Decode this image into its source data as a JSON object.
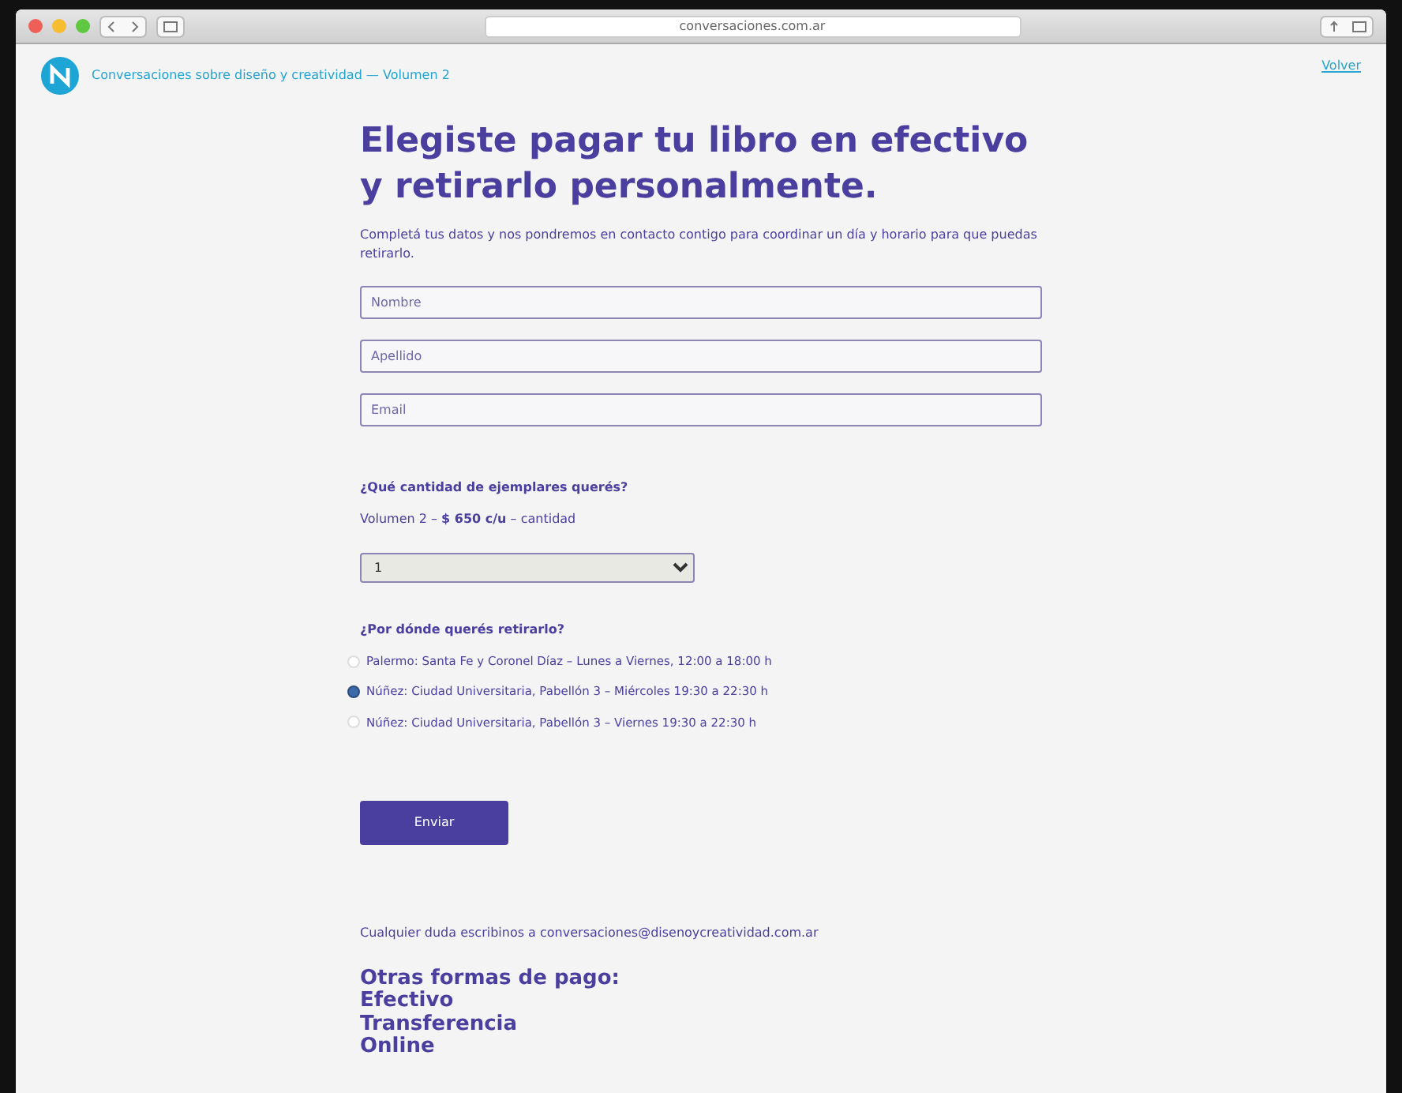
{
  "browser": {
    "address": "conversaciones.com.ar"
  },
  "header": {
    "site_title": "Conversaciones sobre diseño y creatividad — Volumen 2",
    "nav_link": "Volver"
  },
  "title": "Elegiste pagar tu libro en efectivo y retirarlo personalmente.",
  "intro": "Completá tus datos y nos pondremos en contacto contigo para coordinar un día y horario para que puedas retirarlo.",
  "fields": [
    {
      "placeholder": "Nombre"
    },
    {
      "placeholder": "Apellido"
    },
    {
      "placeholder": "Email"
    }
  ],
  "quantity": {
    "question": "¿Qué cantidad de ejemplares querés?",
    "label": "Volumen 2 – **$ 650 c/u** – cantidad",
    "value": "1"
  },
  "pickup": {
    "question": "¿Por dónde querés retirarlo?",
    "options": [
      {
        "label": "Palermo: Santa Fe y Coronel Díaz – Lunes a Viernes, 12:00 a 18:00 h",
        "selected": false
      },
      {
        "label": "Núñez: Ciudad Universitaria, Pabellón 3 – Miércoles 19:30 a 22:30 h",
        "selected": true
      },
      {
        "label": "Núñez: Ciudad Universitaria, Pabellón 3 – Viernes 19:30 a 22:30 h",
        "selected": false
      }
    ]
  },
  "submit": "Enviar",
  "contact": {
    "text": "Cualquier duda escribinos a",
    "email": "conversaciones@disenoycreatividad.com.ar"
  },
  "other_payments": {
    "heading": "Otras formas de pago:",
    "items": [
      "Efectivo",
      "Transferencia",
      "Online"
    ]
  }
}
